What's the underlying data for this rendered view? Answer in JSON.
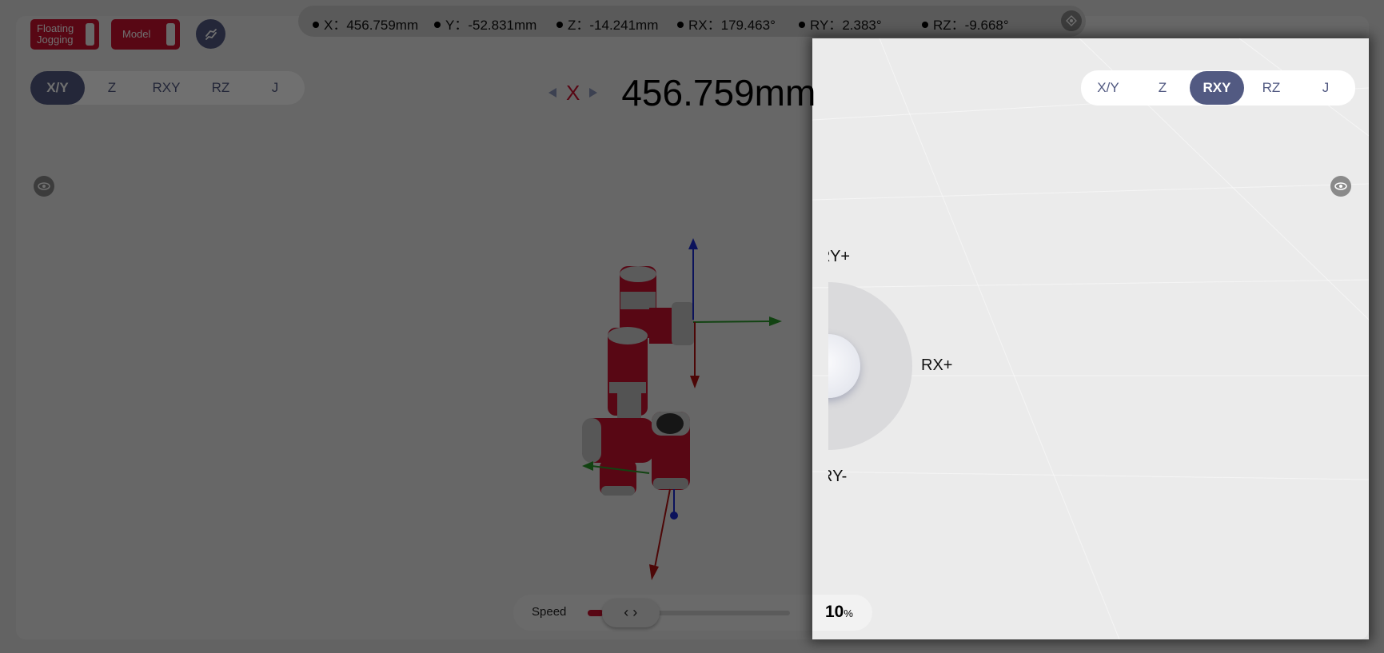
{
  "toolbar": {
    "floating_jogging_label": "Floating Jogging",
    "floating_jogging_on": false,
    "model_label": "Model",
    "model_on": false,
    "link_icon": "link-icon"
  },
  "status": {
    "x": {
      "label": "X：",
      "value": "456.759mm"
    },
    "y": {
      "label": "Y：",
      "value": "-52.831mm"
    },
    "z": {
      "label": "Z：",
      "value": "-14.241mm"
    },
    "rx": {
      "label": "RX：",
      "value": "179.463°"
    },
    "ry": {
      "label": "RY：",
      "value": "2.383°"
    },
    "rz": {
      "label": "RZ：",
      "value": "-9.668°"
    }
  },
  "mode_tabs_left": {
    "items": [
      "X/Y",
      "Z",
      "RXY",
      "RZ",
      "J"
    ],
    "active": "X/Y"
  },
  "mode_tabs_right": {
    "items": [
      "X/Y",
      "Z",
      "RXY",
      "RZ",
      "J"
    ],
    "active": "RXY"
  },
  "axis_readout": {
    "axis": "X",
    "value": "456.759mm"
  },
  "joystick": {
    "up": "RY+",
    "right": "RX+",
    "down": "RY-"
  },
  "speed": {
    "label": "Speed",
    "value": "10",
    "unit": "%",
    "percent": 10
  },
  "colors": {
    "accent": "#525a82",
    "brand_red": "#c8102e",
    "axis_x": "#b01010",
    "axis_y": "#2a9a2a",
    "axis_z": "#1a2ad0"
  }
}
